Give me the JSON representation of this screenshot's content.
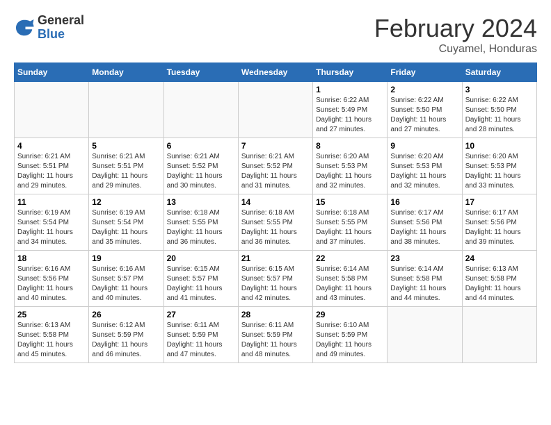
{
  "header": {
    "logo_general": "General",
    "logo_blue": "Blue",
    "month_title": "February 2024",
    "subtitle": "Cuyamel, Honduras"
  },
  "days_of_week": [
    "Sunday",
    "Monday",
    "Tuesday",
    "Wednesday",
    "Thursday",
    "Friday",
    "Saturday"
  ],
  "weeks": [
    [
      {
        "day": "",
        "info": ""
      },
      {
        "day": "",
        "info": ""
      },
      {
        "day": "",
        "info": ""
      },
      {
        "day": "",
        "info": ""
      },
      {
        "day": "1",
        "info": "Sunrise: 6:22 AM\nSunset: 5:49 PM\nDaylight: 11 hours\nand 27 minutes."
      },
      {
        "day": "2",
        "info": "Sunrise: 6:22 AM\nSunset: 5:50 PM\nDaylight: 11 hours\nand 27 minutes."
      },
      {
        "day": "3",
        "info": "Sunrise: 6:22 AM\nSunset: 5:50 PM\nDaylight: 11 hours\nand 28 minutes."
      }
    ],
    [
      {
        "day": "4",
        "info": "Sunrise: 6:21 AM\nSunset: 5:51 PM\nDaylight: 11 hours\nand 29 minutes."
      },
      {
        "day": "5",
        "info": "Sunrise: 6:21 AM\nSunset: 5:51 PM\nDaylight: 11 hours\nand 29 minutes."
      },
      {
        "day": "6",
        "info": "Sunrise: 6:21 AM\nSunset: 5:52 PM\nDaylight: 11 hours\nand 30 minutes."
      },
      {
        "day": "7",
        "info": "Sunrise: 6:21 AM\nSunset: 5:52 PM\nDaylight: 11 hours\nand 31 minutes."
      },
      {
        "day": "8",
        "info": "Sunrise: 6:20 AM\nSunset: 5:53 PM\nDaylight: 11 hours\nand 32 minutes."
      },
      {
        "day": "9",
        "info": "Sunrise: 6:20 AM\nSunset: 5:53 PM\nDaylight: 11 hours\nand 32 minutes."
      },
      {
        "day": "10",
        "info": "Sunrise: 6:20 AM\nSunset: 5:53 PM\nDaylight: 11 hours\nand 33 minutes."
      }
    ],
    [
      {
        "day": "11",
        "info": "Sunrise: 6:19 AM\nSunset: 5:54 PM\nDaylight: 11 hours\nand 34 minutes."
      },
      {
        "day": "12",
        "info": "Sunrise: 6:19 AM\nSunset: 5:54 PM\nDaylight: 11 hours\nand 35 minutes."
      },
      {
        "day": "13",
        "info": "Sunrise: 6:18 AM\nSunset: 5:55 PM\nDaylight: 11 hours\nand 36 minutes."
      },
      {
        "day": "14",
        "info": "Sunrise: 6:18 AM\nSunset: 5:55 PM\nDaylight: 11 hours\nand 36 minutes."
      },
      {
        "day": "15",
        "info": "Sunrise: 6:18 AM\nSunset: 5:55 PM\nDaylight: 11 hours\nand 37 minutes."
      },
      {
        "day": "16",
        "info": "Sunrise: 6:17 AM\nSunset: 5:56 PM\nDaylight: 11 hours\nand 38 minutes."
      },
      {
        "day": "17",
        "info": "Sunrise: 6:17 AM\nSunset: 5:56 PM\nDaylight: 11 hours\nand 39 minutes."
      }
    ],
    [
      {
        "day": "18",
        "info": "Sunrise: 6:16 AM\nSunset: 5:56 PM\nDaylight: 11 hours\nand 40 minutes."
      },
      {
        "day": "19",
        "info": "Sunrise: 6:16 AM\nSunset: 5:57 PM\nDaylight: 11 hours\nand 40 minutes."
      },
      {
        "day": "20",
        "info": "Sunrise: 6:15 AM\nSunset: 5:57 PM\nDaylight: 11 hours\nand 41 minutes."
      },
      {
        "day": "21",
        "info": "Sunrise: 6:15 AM\nSunset: 5:57 PM\nDaylight: 11 hours\nand 42 minutes."
      },
      {
        "day": "22",
        "info": "Sunrise: 6:14 AM\nSunset: 5:58 PM\nDaylight: 11 hours\nand 43 minutes."
      },
      {
        "day": "23",
        "info": "Sunrise: 6:14 AM\nSunset: 5:58 PM\nDaylight: 11 hours\nand 44 minutes."
      },
      {
        "day": "24",
        "info": "Sunrise: 6:13 AM\nSunset: 5:58 PM\nDaylight: 11 hours\nand 44 minutes."
      }
    ],
    [
      {
        "day": "25",
        "info": "Sunrise: 6:13 AM\nSunset: 5:58 PM\nDaylight: 11 hours\nand 45 minutes."
      },
      {
        "day": "26",
        "info": "Sunrise: 6:12 AM\nSunset: 5:59 PM\nDaylight: 11 hours\nand 46 minutes."
      },
      {
        "day": "27",
        "info": "Sunrise: 6:11 AM\nSunset: 5:59 PM\nDaylight: 11 hours\nand 47 minutes."
      },
      {
        "day": "28",
        "info": "Sunrise: 6:11 AM\nSunset: 5:59 PM\nDaylight: 11 hours\nand 48 minutes."
      },
      {
        "day": "29",
        "info": "Sunrise: 6:10 AM\nSunset: 5:59 PM\nDaylight: 11 hours\nand 49 minutes."
      },
      {
        "day": "",
        "info": ""
      },
      {
        "day": "",
        "info": ""
      }
    ]
  ]
}
